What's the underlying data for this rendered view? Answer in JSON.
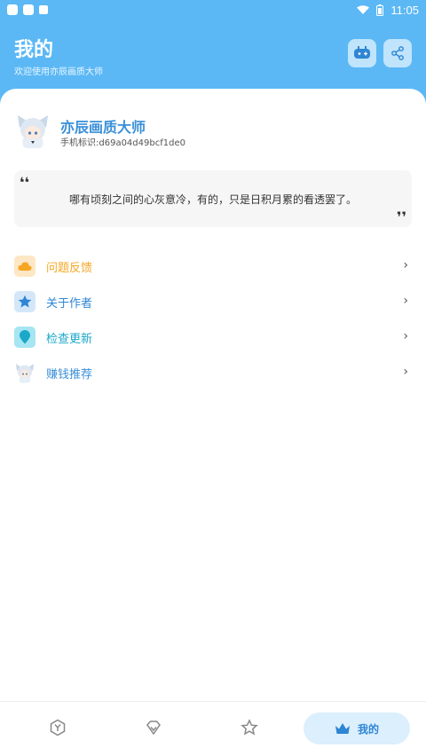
{
  "statusbar": {
    "time": "11:05"
  },
  "header": {
    "title": "我的",
    "subtitle": "欢迎使用亦辰画质大师"
  },
  "profile": {
    "name": "亦辰画质大师",
    "device_id": "手机标识:d69a04d49bcf1de0"
  },
  "quote": {
    "open_mark": "❛❛",
    "text": "哪有顷刻之间的心灰意冷，有的，只是日积月累的看透罢了。",
    "close_mark": "❜❜"
  },
  "menu": {
    "items": [
      {
        "label": "问题反馈",
        "color": "#F5A623",
        "icon": "cloud-icon"
      },
      {
        "label": "关于作者",
        "color": "#2E85D4",
        "icon": "star-icon"
      },
      {
        "label": "检查更新",
        "color": "#1BA8C9",
        "icon": "pin-icon"
      },
      {
        "label": "赚钱推荐",
        "color": "#3a8fd8",
        "icon": "anime-avatar-icon"
      }
    ],
    "chevron": "›"
  },
  "bottomnav": {
    "active_label": "我的"
  },
  "colors": {
    "primary": "#5BB8F5",
    "accent_blue": "#2E85D4"
  }
}
